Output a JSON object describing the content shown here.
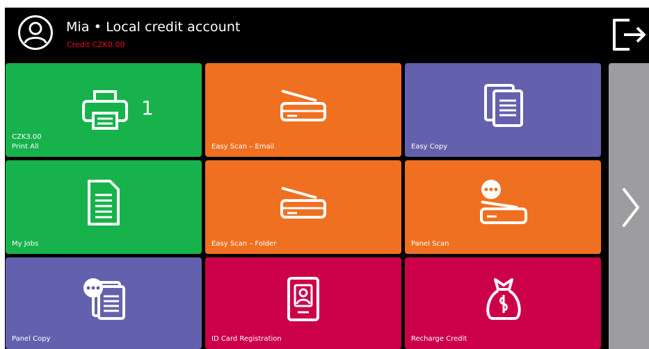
{
  "header": {
    "title": "Mia • Local credit account",
    "credit": "Credit CZK0.00"
  },
  "tiles": [
    {
      "label": "Print All",
      "sub": "CZK3.00",
      "count": "1",
      "icon": "printer-icon",
      "color": "#17b24b"
    },
    {
      "label": "Easy Scan – Email",
      "icon": "scanner-icon",
      "color": "#f07021"
    },
    {
      "label": "Easy Copy",
      "icon": "copy-document-icon",
      "color": "#6361ad"
    },
    {
      "label": "My Jobs",
      "icon": "document-icon",
      "color": "#17b24b"
    },
    {
      "label": "Easy Scan – Folder",
      "icon": "scanner-icon",
      "color": "#f07021"
    },
    {
      "label": "Panel Scan",
      "icon": "panel-scanner-icon",
      "color": "#f07021"
    },
    {
      "label": "Panel Copy",
      "icon": "panel-copy-icon",
      "color": "#6361ad"
    },
    {
      "label": "ID Card Registration",
      "icon": "id-card-icon",
      "color": "#cc0048"
    },
    {
      "label": "Recharge Credit",
      "icon": "money-bag-icon",
      "color": "#cc0048"
    }
  ],
  "nav": {
    "next_icon": "chevron-right-icon",
    "logout_icon": "logout-icon"
  }
}
